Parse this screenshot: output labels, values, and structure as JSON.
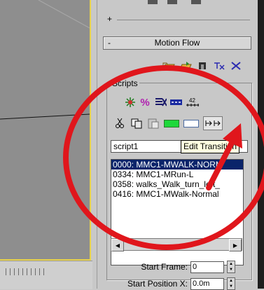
{
  "rollout": {
    "minus": "-",
    "title": "Motion Flow"
  },
  "top_strip": {
    "plus": "+"
  },
  "scripts": {
    "group_label": "Scripts",
    "script_name": "script1"
  },
  "tooltip": {
    "text": "Edit Transition"
  },
  "toolbar": {
    "percent_glyph": "%",
    "counter_glyph": "42"
  },
  "script_list": [
    {
      "text": "0000: MMC1-MWALK-NORM",
      "selected": true
    },
    {
      "text": "0334: MMC1-MRun-L",
      "selected": false
    },
    {
      "text": "0358: walks_Walk_turn_left_",
      "selected": false
    },
    {
      "text": "0416: MMC1-MWalk-Normal",
      "selected": false
    }
  ],
  "fields": {
    "start_frame_label": "Start Frame:",
    "start_frame_value": "0",
    "start_pos_x_label": "Start Position X:",
    "start_pos_x_value": "0.0m"
  },
  "colors": {
    "green_swatch": "#1ed83a",
    "annotation_red": "#e0161c",
    "selection_blue": "#0a246a",
    "viewport_border": "#e8d24a"
  },
  "icons": [
    "load-file-icon",
    "save-file-icon",
    "biped-icon",
    "motion-flow-icon",
    "random-icon",
    "create-transitions-icon",
    "percent-icon",
    "delete-icon",
    "list-icon",
    "counter-icon",
    "cut-icon",
    "copy-icon",
    "paste-icon",
    "edit-transition-icon"
  ]
}
